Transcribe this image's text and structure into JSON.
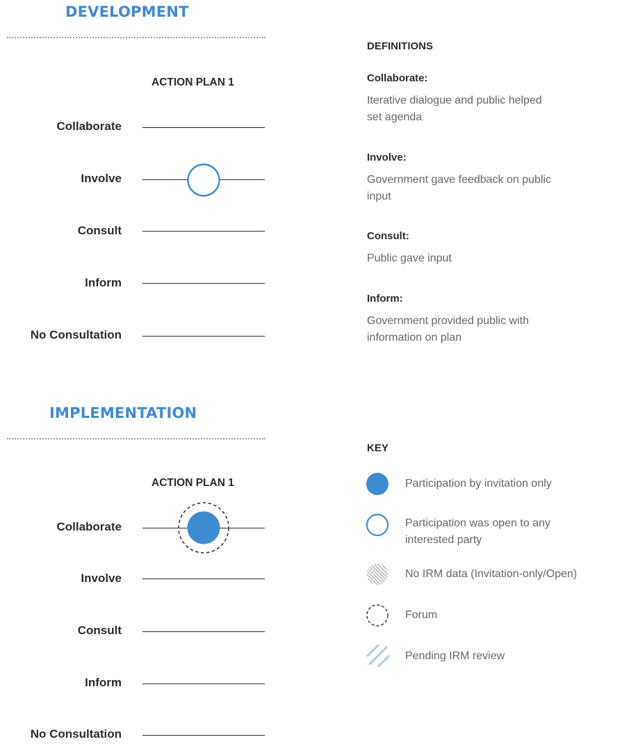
{
  "development": {
    "title": "DEVELOPMENT",
    "column_header": "ACTION PLAN 1",
    "levels": [
      "Collaborate",
      "Involve",
      "Consult",
      "Inform",
      "No Consultation"
    ],
    "marker": {
      "level": "Involve",
      "type": "open"
    }
  },
  "implementation": {
    "title": "IMPLEMENTATION",
    "column_header": "ACTION PLAN 1",
    "levels": [
      "Collaborate",
      "Involve",
      "Consult",
      "Inform",
      "No Consultation"
    ],
    "marker": {
      "level": "Collaborate",
      "type": "invitation-only-forum"
    }
  },
  "definitions": {
    "heading": "DEFINITIONS",
    "items": [
      {
        "term": "Collaborate:",
        "text": "Iterative dialogue and public helped set agenda"
      },
      {
        "term": "Involve:",
        "text": "Government gave feedback on public input"
      },
      {
        "term": "Consult:",
        "text": "Public gave input"
      },
      {
        "term": "Inform:",
        "text": "Government provided public with information on plan"
      }
    ]
  },
  "key": {
    "heading": "KEY",
    "items": [
      {
        "icon": "filled-circle-icon",
        "label": "Participation by invitation only"
      },
      {
        "icon": "open-circle-icon",
        "label": "Participation was open to any interested party"
      },
      {
        "icon": "striped-circle-icon",
        "label": "No IRM data (Invitation-only/Open)"
      },
      {
        "icon": "dashed-circle-icon",
        "label": "Forum"
      },
      {
        "icon": "diagonal-lines-icon",
        "label": "Pending IRM review"
      }
    ]
  },
  "colors": {
    "accent": "#3f8bd0",
    "marker_fill": "#3f8bd0",
    "text_dark": "#2b2b2b",
    "text_muted": "#666666"
  }
}
